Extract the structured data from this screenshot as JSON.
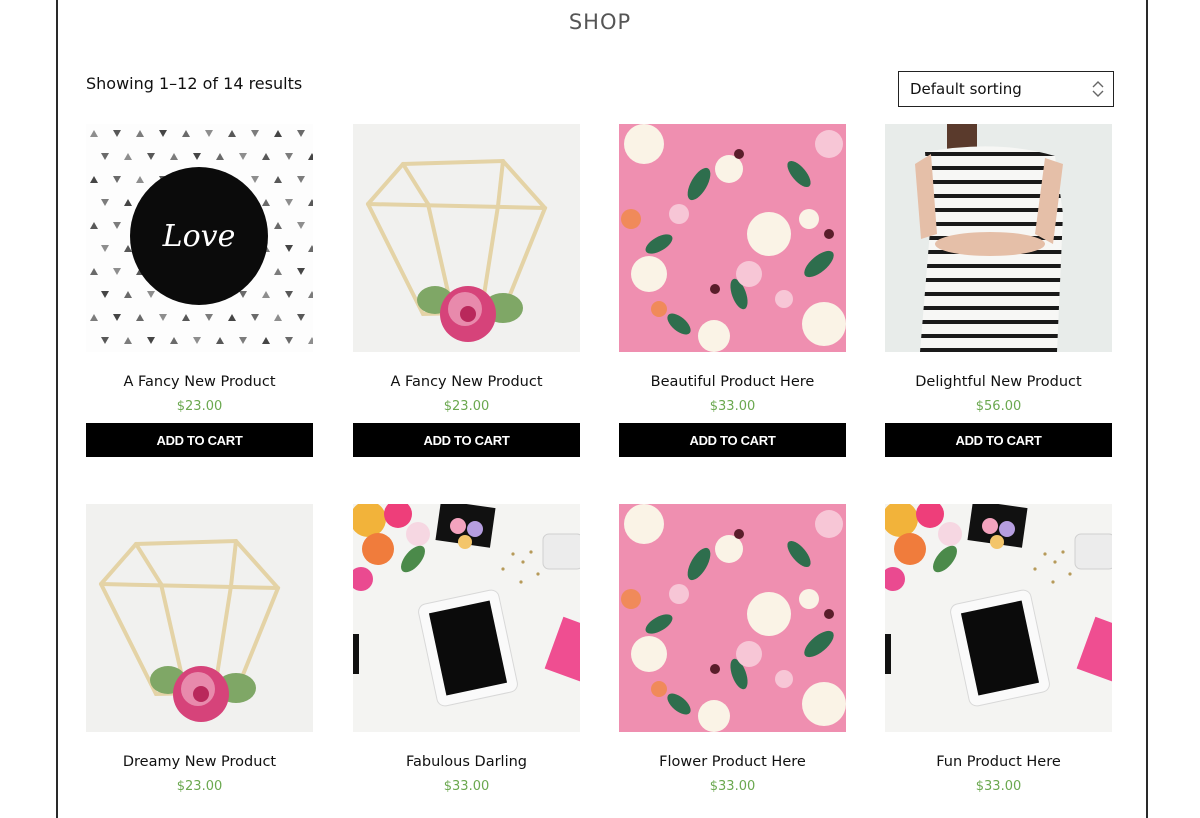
{
  "page": {
    "title": "SHOP",
    "result_count": "Showing 1–12 of 14 results",
    "sort": {
      "selected": "Default sorting"
    }
  },
  "colors": {
    "price": "#6ba84f",
    "button_bg": "#000000",
    "button_text": "#ffffff"
  },
  "products": [
    {
      "name": "A Fancy New Product",
      "price": "$23.00",
      "button": "ADD TO CART",
      "image": "love-print"
    },
    {
      "name": "A Fancy New Product",
      "price": "$23.00",
      "button": "ADD TO CART",
      "image": "gold-diamond-frame"
    },
    {
      "name": "Beautiful Product Here",
      "price": "$33.00",
      "button": "ADD TO CART",
      "image": "pink-flowers"
    },
    {
      "name": "Delightful New Product",
      "price": "$56.00",
      "button": "ADD TO CART",
      "image": "striped-dress"
    },
    {
      "name": "Dreamy New Product",
      "price": "$23.00",
      "image": "gold-diamond-frame"
    },
    {
      "name": "Fabulous Darling",
      "price": "$33.00",
      "image": "tablet-flatlay"
    },
    {
      "name": "Flower Product Here",
      "price": "$33.00",
      "image": "pink-flowers"
    },
    {
      "name": "Fun Product Here",
      "price": "$33.00",
      "image": "tablet-flatlay"
    }
  ],
  "love_text": "Love"
}
